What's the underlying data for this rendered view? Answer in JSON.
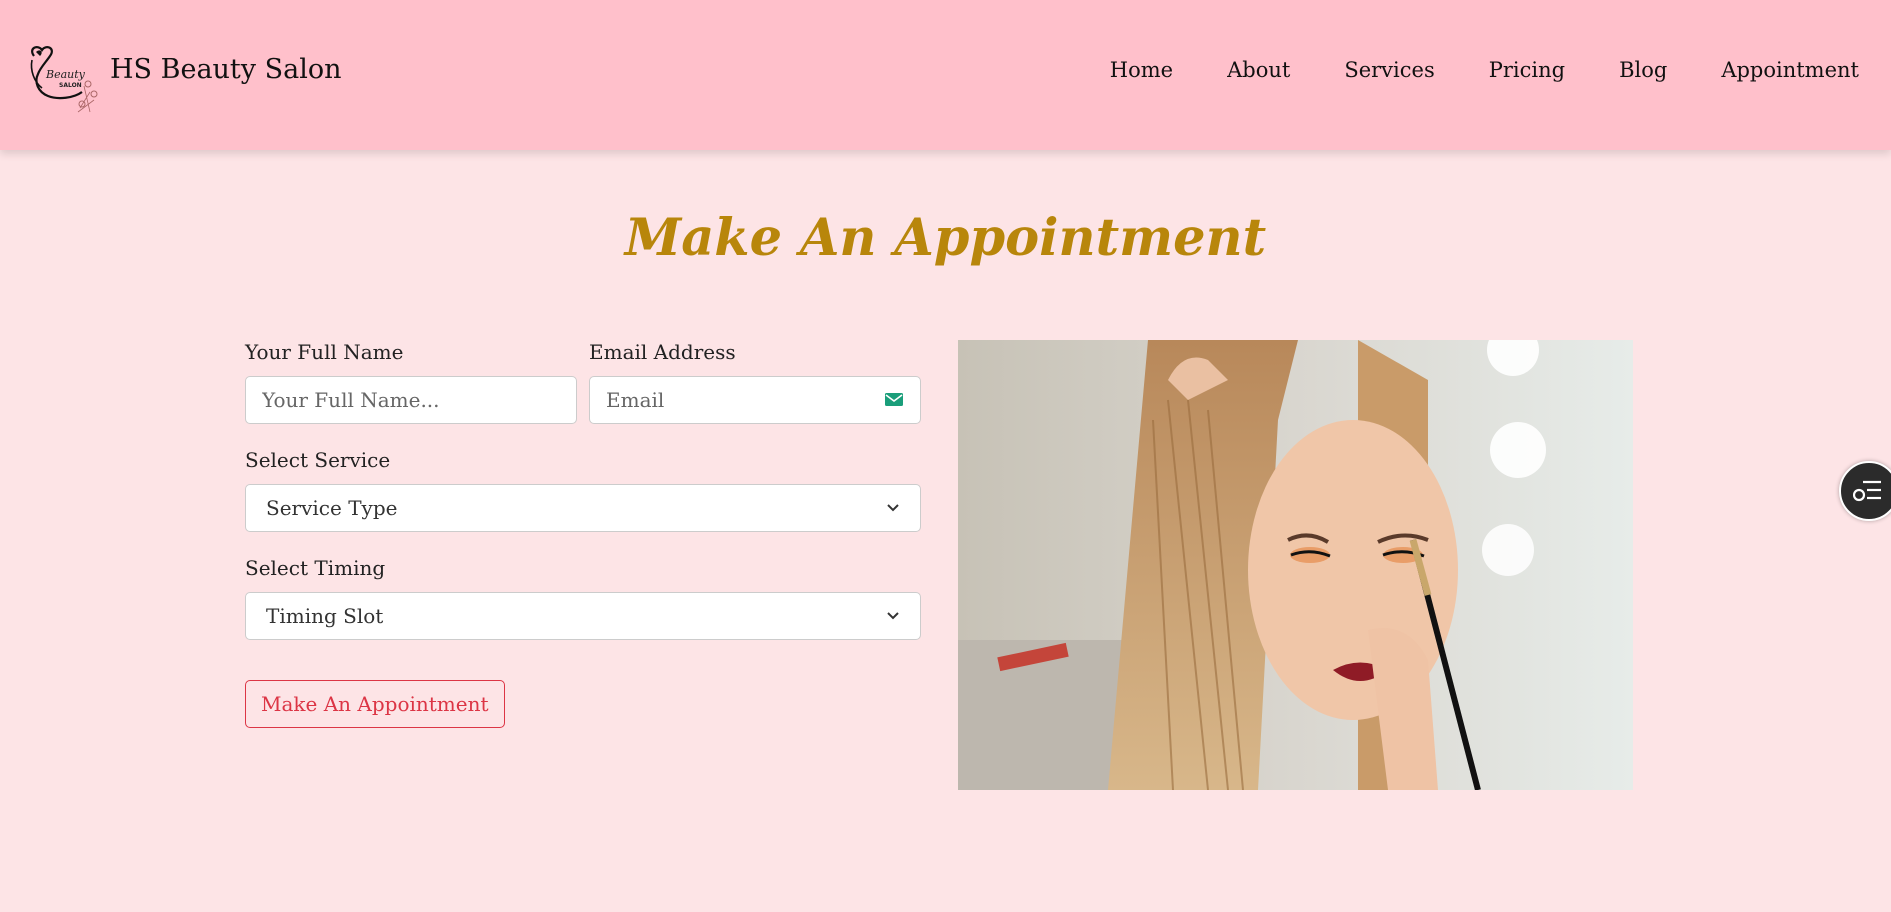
{
  "header": {
    "logo_text": "Beauty",
    "logo_sub": "SALON",
    "site_title": "HS Beauty Salon",
    "nav": [
      "Home",
      "About",
      "Services",
      "Pricing",
      "Blog",
      "Appointment"
    ]
  },
  "page": {
    "heading": "Make An Appointment"
  },
  "form": {
    "name_label": "Your Full Name",
    "name_placeholder": "Your Full Name...",
    "email_label": "Email Address",
    "email_placeholder": "Email",
    "service_label": "Select Service",
    "service_value": "Service Type",
    "timing_label": "Select Timing",
    "timing_value": "Timing Slot",
    "submit_label": "Make An Appointment"
  },
  "colors": {
    "header_bg": "#ffc0cb",
    "page_bg": "#fde4e6",
    "heading": "#b8860b",
    "button": "#dc3545"
  },
  "icons": {
    "email": "envelope-icon",
    "floating": "list-settings-icon",
    "select": "chevron-down-icon"
  }
}
